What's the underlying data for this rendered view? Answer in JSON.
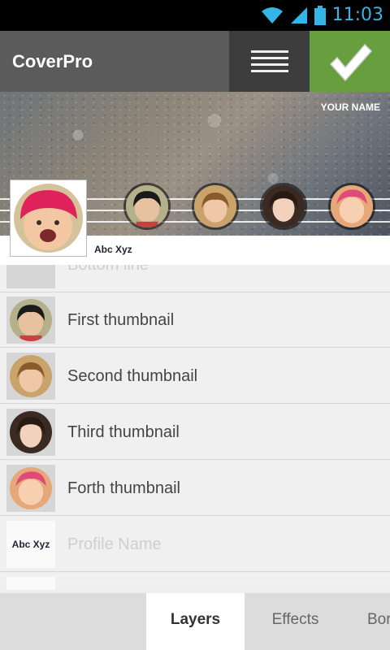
{
  "status": {
    "time": "11:03"
  },
  "app": {
    "title": "CoverPro"
  },
  "cover": {
    "name_text": "YOUR NAME",
    "profile_caption": "Abc Xyz"
  },
  "layers": [
    {
      "label": "Bottom line",
      "dim": true
    },
    {
      "label": "First thumbnail"
    },
    {
      "label": "Second thumbnail"
    },
    {
      "label": "Third thumbnail"
    },
    {
      "label": "Forth thumbnail"
    },
    {
      "label": "Profile Name",
      "dim": true,
      "thumb_text": "Abc Xyz"
    }
  ],
  "tabs": [
    {
      "label": "Layers",
      "active": true
    },
    {
      "label": "Effects"
    },
    {
      "label": "Bor"
    }
  ],
  "colors": {
    "accent": "#679f3f",
    "clock": "#33b5e5",
    "actionbar": "#5b5b5b"
  }
}
